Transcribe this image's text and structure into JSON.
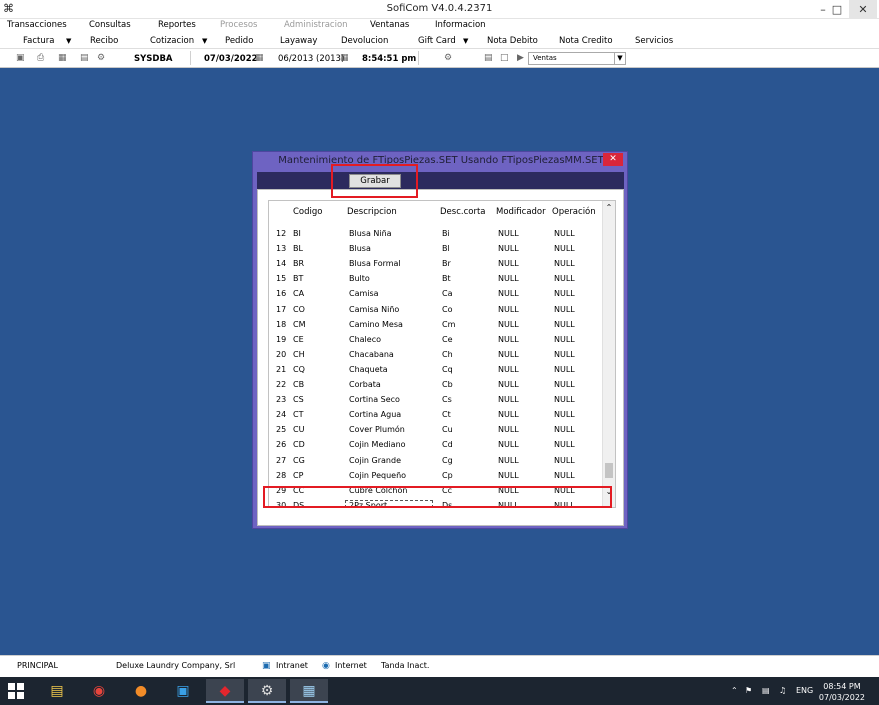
{
  "window": {
    "app_icon": "sofi-app-icon",
    "title": "SofiCom V4.0.4.2371",
    "minimize": "–",
    "restore": "□",
    "close": "✕"
  },
  "menu": [
    "Transacciones",
    "Consultas",
    "Reportes",
    "Procesos",
    "Administracion",
    "Ventanas",
    "Informacion"
  ],
  "toolbar": {
    "factura": "Factura",
    "recibo": "Recibo",
    "cotizacion": "Cotizacion",
    "pedido": "Pedido",
    "layaway": "Layaway",
    "devolucion": "Devolucion",
    "gift_card": "Gift Card",
    "nota_debito": "Nota Debito",
    "nota_credito": "Nota Credito",
    "servicios": "Servicios"
  },
  "status_strip": {
    "user": "SYSDBA",
    "date": "07/03/2022",
    "period": "06/2013 (2013)",
    "time": "8:54:51 pm",
    "module": "Ventas"
  },
  "dialog": {
    "title": "Mantenimiento de FTiposPiezas.SET Usando FTiposPiezasMM.SET",
    "close": "✕",
    "save_button": "Grabar"
  },
  "grid": {
    "columns": [
      "Codigo",
      "Descripcion",
      "Desc.corta",
      "Modificador",
      "Operación"
    ],
    "rows": [
      {
        "n": "12",
        "codigo": "BI",
        "descripcion": "Blusa Niña",
        "corta": "Bi",
        "modificador": "NULL",
        "operacion": "NULL"
      },
      {
        "n": "13",
        "codigo": "BL",
        "descripcion": "Blusa",
        "corta": "Bl",
        "modificador": "NULL",
        "operacion": "NULL"
      },
      {
        "n": "14",
        "codigo": "BR",
        "descripcion": "Blusa Formal",
        "corta": "Br",
        "modificador": "NULL",
        "operacion": "NULL"
      },
      {
        "n": "15",
        "codigo": "BT",
        "descripcion": "Bulto",
        "corta": "Bt",
        "modificador": "NULL",
        "operacion": "NULL"
      },
      {
        "n": "16",
        "codigo": "CA",
        "descripcion": "Camisa",
        "corta": "Ca",
        "modificador": "NULL",
        "operacion": "NULL"
      },
      {
        "n": "17",
        "codigo": "CO",
        "descripcion": "Camisa Niño",
        "corta": "Co",
        "modificador": "NULL",
        "operacion": "NULL"
      },
      {
        "n": "18",
        "codigo": "CM",
        "descripcion": "Camino Mesa",
        "corta": "Cm",
        "modificador": "NULL",
        "operacion": "NULL"
      },
      {
        "n": "19",
        "codigo": "CE",
        "descripcion": "Chaleco",
        "corta": "Ce",
        "modificador": "NULL",
        "operacion": "NULL"
      },
      {
        "n": "20",
        "codigo": "CH",
        "descripcion": "Chacabana",
        "corta": "Ch",
        "modificador": "NULL",
        "operacion": "NULL"
      },
      {
        "n": "21",
        "codigo": "CQ",
        "descripcion": "Chaqueta",
        "corta": "Cq",
        "modificador": "NULL",
        "operacion": "NULL"
      },
      {
        "n": "22",
        "codigo": "CB",
        "descripcion": "Corbata",
        "corta": "Cb",
        "modificador": "NULL",
        "operacion": "NULL"
      },
      {
        "n": "23",
        "codigo": "CS",
        "descripcion": "Cortina Seco",
        "corta": "Cs",
        "modificador": "NULL",
        "operacion": "NULL"
      },
      {
        "n": "24",
        "codigo": "CT",
        "descripcion": "Cortina Agua",
        "corta": "Ct",
        "modificador": "NULL",
        "operacion": "NULL"
      },
      {
        "n": "25",
        "codigo": "CU",
        "descripcion": "Cover Plumón",
        "corta": "Cu",
        "modificador": "NULL",
        "operacion": "NULL"
      },
      {
        "n": "26",
        "codigo": "CD",
        "descripcion": "Cojin Mediano",
        "corta": "Cd",
        "modificador": "NULL",
        "operacion": "NULL"
      },
      {
        "n": "27",
        "codigo": "CG",
        "descripcion": "Cojin Grande",
        "corta": "Cg",
        "modificador": "NULL",
        "operacion": "NULL"
      },
      {
        "n": "28",
        "codigo": "CP",
        "descripcion": "Cojin Pequeño",
        "corta": "Cp",
        "modificador": "NULL",
        "operacion": "NULL"
      },
      {
        "n": "29",
        "codigo": "CC",
        "descripcion": "Cubre Colchón",
        "corta": "Cc",
        "modificador": "NULL",
        "operacion": "NULL"
      },
      {
        "n": "30",
        "codigo": "DS",
        "descripcion": "2Pz Sport",
        "corta": "Ds",
        "modificador": "NULL",
        "operacion": "NULL"
      }
    ]
  },
  "footer": {
    "section": "PRINCIPAL",
    "company": "Deluxe Laundry Company, Srl",
    "intranet": "Intranet",
    "internet": "Internet",
    "tanda": "Tanda Inact."
  },
  "taskbar": {
    "language": "ENG",
    "time": "08:54 PM",
    "date": "07/03/2022",
    "apps": [
      "file-explorer-icon",
      "chrome-icon",
      "app-icon",
      "teamviewer-icon",
      "anydesk-icon",
      "soficom-icon",
      "notepad-icon"
    ]
  },
  "colors": {
    "desktop": "#2a5591",
    "dialog_frame": "#6e63c2",
    "highlight": "#e31b23"
  }
}
